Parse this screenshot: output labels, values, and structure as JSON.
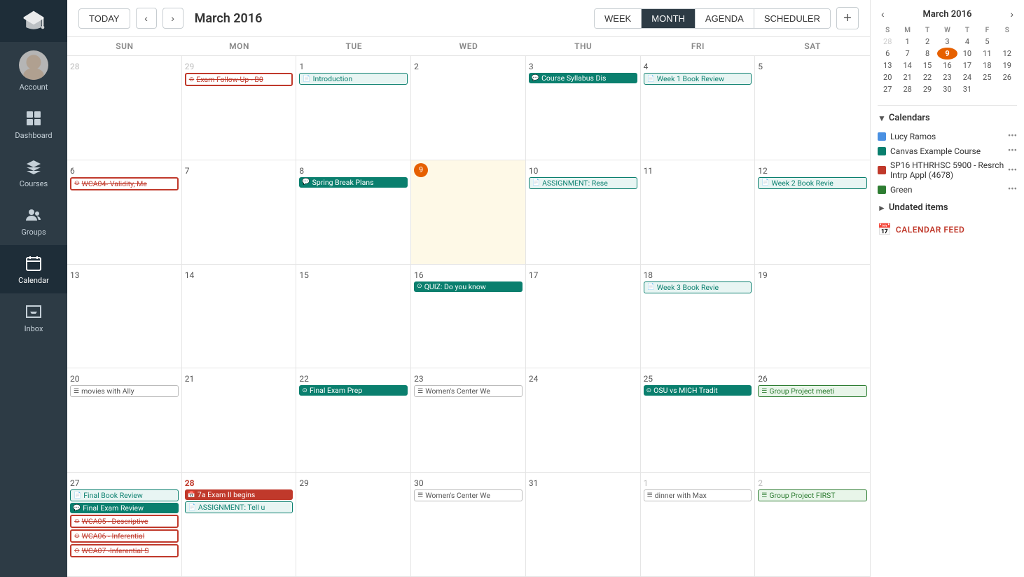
{
  "sidebar": {
    "items": [
      {
        "label": "Account",
        "icon": "account"
      },
      {
        "label": "Dashboard",
        "icon": "dashboard"
      },
      {
        "label": "Courses",
        "icon": "courses"
      },
      {
        "label": "Groups",
        "icon": "groups"
      },
      {
        "label": "Calendar",
        "icon": "calendar",
        "active": true
      },
      {
        "label": "Inbox",
        "icon": "inbox"
      }
    ]
  },
  "header": {
    "today_label": "TODAY",
    "title": "March 2016",
    "views": [
      "WEEK",
      "MONTH",
      "AGENDA",
      "SCHEDULER"
    ],
    "active_view": "MONTH"
  },
  "day_headers": [
    "SUN",
    "MON",
    "TUE",
    "WED",
    "THU",
    "FRI",
    "SAT"
  ],
  "weeks": [
    {
      "days": [
        {
          "num": "28",
          "other": true,
          "events": []
        },
        {
          "num": "29",
          "other": true,
          "events": [
            {
              "text": "Exam Follow-Up - B0",
              "type": "red-outline",
              "icon": "⊙"
            }
          ]
        },
        {
          "num": "1",
          "events": [
            {
              "text": "Introduction",
              "type": "teal",
              "icon": "📄"
            }
          ]
        },
        {
          "num": "2",
          "events": []
        },
        {
          "num": "3",
          "events": [
            {
              "text": "Course Syllabus Dis",
              "type": "teal-solid",
              "icon": "💬"
            }
          ]
        },
        {
          "num": "4",
          "events": [
            {
              "text": "Week 1 Book Review",
              "type": "teal",
              "icon": "📄"
            }
          ]
        },
        {
          "num": "5",
          "events": []
        }
      ]
    },
    {
      "days": [
        {
          "num": "6",
          "events": [
            {
              "text": "WCA04- Validity, Me",
              "type": "red-outline",
              "icon": "⊙"
            }
          ]
        },
        {
          "num": "7",
          "events": []
        },
        {
          "num": "8",
          "events": [
            {
              "text": "Spring Break Plans",
              "type": "teal-solid",
              "icon": "💬"
            }
          ]
        },
        {
          "num": "9",
          "highlighted": true,
          "events": []
        },
        {
          "num": "10",
          "events": [
            {
              "text": "ASSIGNMENT: Rese",
              "type": "teal",
              "icon": "📄"
            }
          ]
        },
        {
          "num": "11",
          "events": []
        },
        {
          "num": "12",
          "events": [
            {
              "text": "Week 2 Book Revie",
              "type": "teal",
              "icon": "📄"
            }
          ]
        }
      ]
    },
    {
      "days": [
        {
          "num": "13",
          "events": []
        },
        {
          "num": "14",
          "events": []
        },
        {
          "num": "15",
          "events": []
        },
        {
          "num": "16",
          "events": [
            {
              "text": "QUIZ: Do you know",
              "type": "teal-solid",
              "icon": "⊙"
            }
          ]
        },
        {
          "num": "17",
          "events": []
        },
        {
          "num": "18",
          "events": [
            {
              "text": "Week 3 Book Revie",
              "type": "teal",
              "icon": "📄"
            }
          ]
        },
        {
          "num": "19",
          "events": []
        }
      ]
    },
    {
      "days": [
        {
          "num": "20",
          "events": [
            {
              "text": "movies with Ally",
              "type": "gray-outline",
              "icon": "☰"
            }
          ]
        },
        {
          "num": "21",
          "events": []
        },
        {
          "num": "22",
          "events": [
            {
              "text": "Final Exam Prep",
              "type": "teal-solid",
              "icon": "⊙"
            }
          ]
        },
        {
          "num": "23",
          "events": [
            {
              "text": "Women's Center We",
              "type": "gray-outline",
              "icon": "☰"
            }
          ]
        },
        {
          "num": "24",
          "events": []
        },
        {
          "num": "25",
          "events": [
            {
              "text": "OSU vs MICH Tradit",
              "type": "teal-solid",
              "icon": "⊙"
            }
          ]
        },
        {
          "num": "26",
          "events": [
            {
              "text": "Group Project meeti",
              "type": "green-outline",
              "icon": "☰"
            }
          ]
        }
      ]
    },
    {
      "days": [
        {
          "num": "27",
          "events": [
            {
              "text": "Final Book Review",
              "type": "teal",
              "icon": "📄"
            },
            {
              "text": "Final Exam Review",
              "type": "teal-solid",
              "icon": "💬"
            },
            {
              "text": "WCA05 - Descriptive",
              "type": "red-outline",
              "icon": "⊙"
            },
            {
              "text": "WCA06 - Inferential",
              "type": "red-outline",
              "icon": "⊙"
            },
            {
              "text": "WCA07 -Inferential S",
              "type": "red-outline",
              "icon": "⊙"
            }
          ]
        },
        {
          "num": "28",
          "events": [
            {
              "text": "7a Exam II begins",
              "type": "red-solid",
              "icon": "📅"
            },
            {
              "text": "ASSIGNMENT: Tell u",
              "type": "teal",
              "icon": "📄"
            }
          ]
        },
        {
          "num": "29",
          "events": []
        },
        {
          "num": "30",
          "events": [
            {
              "text": "Women's Center We",
              "type": "gray-outline",
              "icon": "☰"
            }
          ]
        },
        {
          "num": "31",
          "events": []
        },
        {
          "num": "1",
          "other": true,
          "events": [
            {
              "text": "dinner with Max",
              "type": "gray-outline",
              "icon": "☰"
            }
          ]
        },
        {
          "num": "2",
          "other": true,
          "events": [
            {
              "text": "Group Project FIRST",
              "type": "green-outline",
              "icon": "☰"
            }
          ]
        }
      ]
    }
  ],
  "mini_cal": {
    "title": "March 2016",
    "day_headers": [
      "S",
      "M",
      "T",
      "W",
      "T",
      "F",
      "S"
    ],
    "weeks": [
      [
        "28",
        "1",
        "2",
        "3",
        "4",
        "5",
        ""
      ],
      [
        "6",
        "7",
        "8",
        "9",
        "10",
        "11",
        "12"
      ],
      [
        "13",
        "14",
        "15",
        "16",
        "17",
        "18",
        "19"
      ],
      [
        "20",
        "21",
        "22",
        "23",
        "24",
        "25",
        "26"
      ],
      [
        "27",
        "28",
        "29",
        "30",
        "31",
        "",
        ""
      ],
      [
        "",
        "",
        "",
        "",
        "",
        "",
        ""
      ]
    ],
    "today": "9",
    "other_days_first": [
      "28"
    ],
    "other_days_last": [
      "",
      ""
    ]
  },
  "calendars_section": {
    "label": "Calendars",
    "items": [
      {
        "name": "Lucy Ramos",
        "color": "#4a90e2"
      },
      {
        "name": "Canvas Example Course",
        "color": "#0a7f6e"
      },
      {
        "name": "SP16 HTHRHSC 5900 - Resrch Intrp Appl (4678)",
        "color": "#c0392b"
      },
      {
        "name": "Green",
        "color": "#2e7d32"
      }
    ]
  },
  "undated_label": "Undated items",
  "cal_feed_label": "CALENDAR FEED"
}
